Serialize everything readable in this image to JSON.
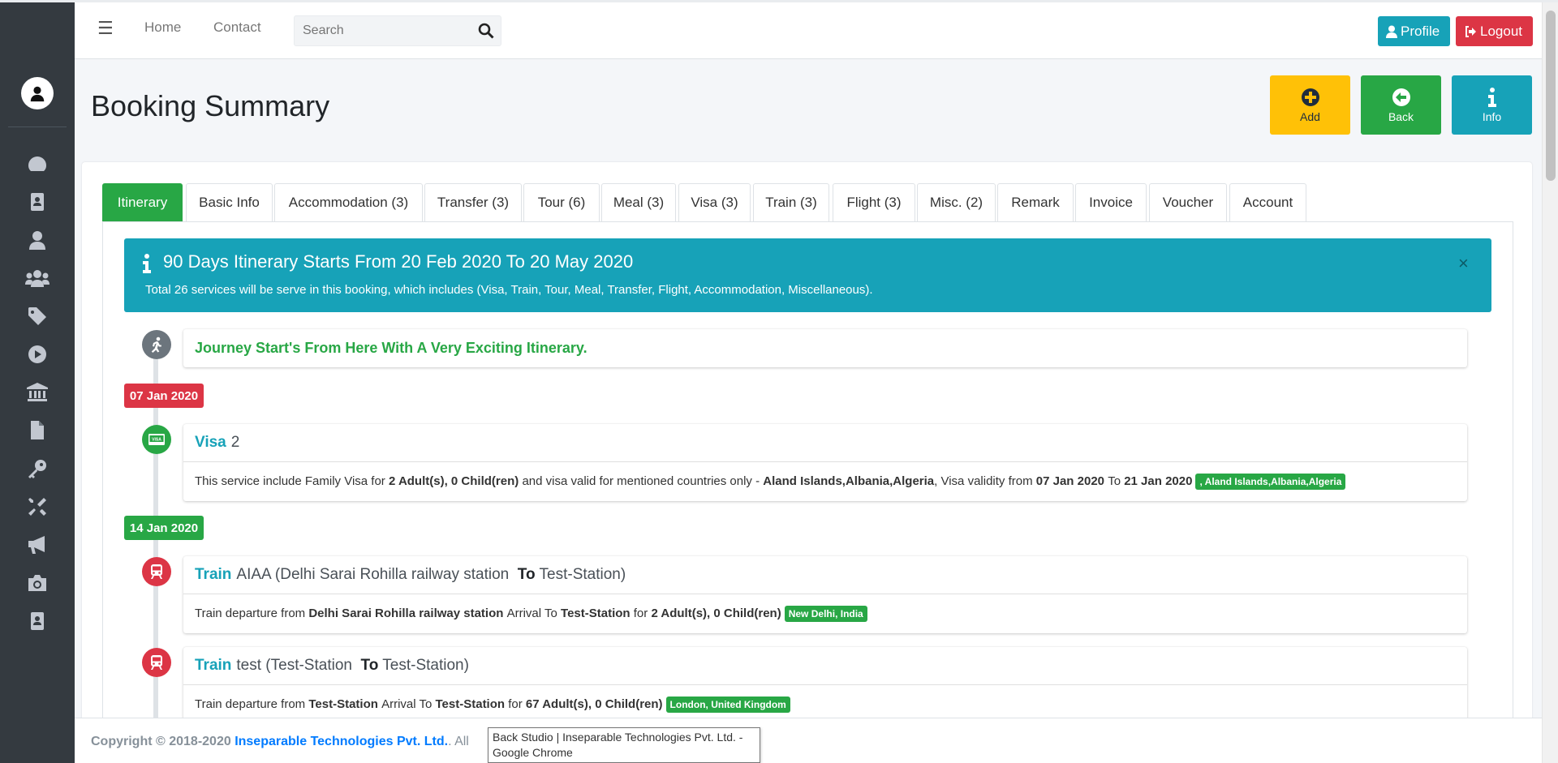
{
  "navbar": {
    "home": "Home",
    "contact": "Contact",
    "search_placeholder": "Search",
    "profile": "Profile",
    "logout": "Logout"
  },
  "page": {
    "title": "Booking Summary"
  },
  "actions": {
    "add": "Add",
    "back": "Back",
    "info": "Info"
  },
  "tabs": [
    {
      "label": "Itinerary"
    },
    {
      "label": "Basic Info"
    },
    {
      "label": "Accommodation (3)"
    },
    {
      "label": "Transfer (3)"
    },
    {
      "label": "Tour (6)"
    },
    {
      "label": "Meal (3)"
    },
    {
      "label": "Visa (3)"
    },
    {
      "label": "Train (3)"
    },
    {
      "label": "Flight (3)"
    },
    {
      "label": "Misc. (2)"
    },
    {
      "label": "Remark"
    },
    {
      "label": "Invoice"
    },
    {
      "label": "Voucher"
    },
    {
      "label": "Account"
    }
  ],
  "alert": {
    "title": "90 Days Itinerary Starts From 20 Feb 2020 To 20 May 2020",
    "description": "Total 26 services will be serve in this booking, which includes (Visa, Train, Tour, Meal, Transfer, Flight, Accommodation, Miscellaneous).",
    "close": "×"
  },
  "timeline": {
    "start_text": "Journey Start's From Here With A Very Exciting Itinerary.",
    "dates": [
      "07 Jan 2020",
      "14 Jan 2020"
    ],
    "visa": {
      "service": "Visa",
      "name": "2",
      "p1": "This service include Family Visa for ",
      "persons": "2 Adult(s), 0 Child(ren)",
      "p2": " and visa valid for mentioned countries only - ",
      "countries": "Aland Islands,Albania,Algeria",
      "p3": ", Visa validity from ",
      "from": "07 Jan 2020",
      "p4": " To ",
      "to": "21 Jan 2020",
      "badge": ", Aland Islands,Albania,Algeria"
    },
    "train1": {
      "service": "Train",
      "name": "AIAA (Delhi Sarai Rohilla railway station ",
      "to_word": "To",
      "dest": " Test-Station)",
      "p1": "Train departure from ",
      "departure": "Delhi Sarai Rohilla railway station",
      "p2": " Arrival To ",
      "arrival": "Test-Station",
      "p3": " for ",
      "persons": "2 Adult(s), 0 Child(ren)",
      "badge": "New Delhi, India"
    },
    "train2": {
      "service": "Train",
      "name": "test (Test-Station ",
      "to_word": "To",
      "dest": " Test-Station)",
      "p1": "Train departure from ",
      "departure": "Test-Station",
      "p2": " Arrival To ",
      "arrival": "Test-Station",
      "p3": " for ",
      "persons": "67 Adult(s), 0 Child(ren)",
      "badge": "London, United Kingdom"
    }
  },
  "footer": {
    "copyright": "Copyright © 2018-2020 ",
    "company": "Inseparable Technologies Pvt. Ltd.",
    "rest": ". All",
    "tooltip": "Back Studio | Inseparable Technologies Pvt. Ltd. - Google Chrome"
  },
  "colors": {
    "sidebar": "#343a40",
    "primary_green": "#28a745",
    "info": "#17a2b8",
    "danger": "#dc3545",
    "warning": "#ffc107"
  },
  "icons": [
    "bars-icon",
    "search-icon",
    "user-icon",
    "sign-out-icon",
    "plus-circle-icon",
    "arrow-left-circle-icon",
    "info-icon",
    "running-icon",
    "visa-icon",
    "train-icon"
  ]
}
